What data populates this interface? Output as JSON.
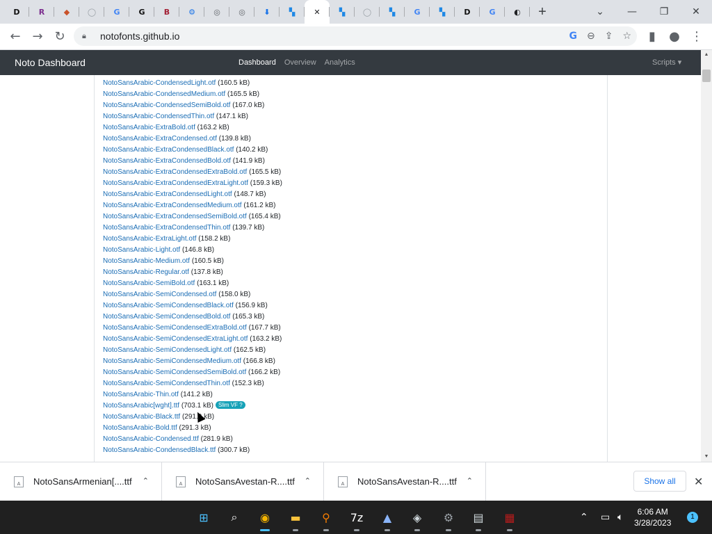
{
  "browser": {
    "tabs": [
      {
        "icon": "dafont-icon",
        "glyph": "D",
        "color": "#111111"
      },
      {
        "icon": "winrar-icon",
        "glyph": "R",
        "color": "#7b2d8e"
      },
      {
        "icon": "extension-icon",
        "glyph": "◆",
        "color": "#c9522a"
      },
      {
        "icon": "github-icon",
        "glyph": "◯",
        "color": "#9aa0a6"
      },
      {
        "icon": "google-icon",
        "glyph": "G",
        "color": "#4285f4"
      },
      {
        "icon": "google-g-icon",
        "glyph": "G",
        "color": "#111111"
      },
      {
        "icon": "font-book-icon",
        "glyph": "B",
        "color": "#a32035"
      },
      {
        "icon": "settings-icon",
        "glyph": "⚙",
        "color": "#1a73e8"
      },
      {
        "icon": "globe-icon",
        "glyph": "◎",
        "color": "#5f6368"
      },
      {
        "icon": "globe-icon",
        "glyph": "◎",
        "color": "#5f6368"
      },
      {
        "icon": "download-icon",
        "glyph": "⬇",
        "color": "#1a73e8"
      },
      {
        "icon": "noto-icon",
        "glyph": "▚",
        "color": "#1e88e5"
      },
      {
        "icon": "active-tab-close-icon",
        "glyph": "✕",
        "color": "#202124"
      },
      {
        "icon": "noto-icon",
        "glyph": "▚",
        "color": "#1e88e5"
      },
      {
        "icon": "github-icon",
        "glyph": "◯",
        "color": "#9aa0a6"
      },
      {
        "icon": "noto-icon",
        "glyph": "▚",
        "color": "#1e88e5"
      },
      {
        "icon": "google-icon",
        "glyph": "G",
        "color": "#4285f4"
      },
      {
        "icon": "noto-icon",
        "glyph": "▚",
        "color": "#1e88e5"
      },
      {
        "icon": "dafont-icon",
        "glyph": "D",
        "color": "#111111"
      },
      {
        "icon": "google-icon",
        "glyph": "G",
        "color": "#4285f4"
      },
      {
        "icon": "globe-icon",
        "glyph": "◐",
        "color": "#202124"
      }
    ],
    "url": "notofonts.github.io"
  },
  "site": {
    "brand": "Noto Dashboard",
    "nav": [
      "Dashboard",
      "Overview",
      "Analytics"
    ],
    "scripts": "Scripts"
  },
  "files": [
    {
      "name": "NotoSansArabic-CondensedLight.otf",
      "size": "(160.5 kB)"
    },
    {
      "name": "NotoSansArabic-CondensedMedium.otf",
      "size": "(165.5 kB)"
    },
    {
      "name": "NotoSansArabic-CondensedSemiBold.otf",
      "size": "(167.0 kB)"
    },
    {
      "name": "NotoSansArabic-CondensedThin.otf",
      "size": "(147.1 kB)"
    },
    {
      "name": "NotoSansArabic-ExtraBold.otf",
      "size": "(163.2 kB)"
    },
    {
      "name": "NotoSansArabic-ExtraCondensed.otf",
      "size": "(139.8 kB)"
    },
    {
      "name": "NotoSansArabic-ExtraCondensedBlack.otf",
      "size": "(140.2 kB)"
    },
    {
      "name": "NotoSansArabic-ExtraCondensedBold.otf",
      "size": "(141.9 kB)"
    },
    {
      "name": "NotoSansArabic-ExtraCondensedExtraBold.otf",
      "size": "(165.5 kB)"
    },
    {
      "name": "NotoSansArabic-ExtraCondensedExtraLight.otf",
      "size": "(159.3 kB)"
    },
    {
      "name": "NotoSansArabic-ExtraCondensedLight.otf",
      "size": "(148.7 kB)"
    },
    {
      "name": "NotoSansArabic-ExtraCondensedMedium.otf",
      "size": "(161.2 kB)"
    },
    {
      "name": "NotoSansArabic-ExtraCondensedSemiBold.otf",
      "size": "(165.4 kB)"
    },
    {
      "name": "NotoSansArabic-ExtraCondensedThin.otf",
      "size": "(139.7 kB)"
    },
    {
      "name": "NotoSansArabic-ExtraLight.otf",
      "size": "(158.2 kB)"
    },
    {
      "name": "NotoSansArabic-Light.otf",
      "size": "(146.8 kB)"
    },
    {
      "name": "NotoSansArabic-Medium.otf",
      "size": "(160.5 kB)"
    },
    {
      "name": "NotoSansArabic-Regular.otf",
      "size": "(137.8 kB)"
    },
    {
      "name": "NotoSansArabic-SemiBold.otf",
      "size": "(163.1 kB)"
    },
    {
      "name": "NotoSansArabic-SemiCondensed.otf",
      "size": "(158.0 kB)"
    },
    {
      "name": "NotoSansArabic-SemiCondensedBlack.otf",
      "size": "(156.9 kB)"
    },
    {
      "name": "NotoSansArabic-SemiCondensedBold.otf",
      "size": "(165.3 kB)"
    },
    {
      "name": "NotoSansArabic-SemiCondensedExtraBold.otf",
      "size": "(167.7 kB)"
    },
    {
      "name": "NotoSansArabic-SemiCondensedExtraLight.otf",
      "size": "(163.2 kB)"
    },
    {
      "name": "NotoSansArabic-SemiCondensedLight.otf",
      "size": "(162.5 kB)"
    },
    {
      "name": "NotoSansArabic-SemiCondensedMedium.otf",
      "size": "(166.8 kB)"
    },
    {
      "name": "NotoSansArabic-SemiCondensedSemiBold.otf",
      "size": "(166.2 kB)"
    },
    {
      "name": "NotoSansArabic-SemiCondensedThin.otf",
      "size": "(152.3 kB)"
    },
    {
      "name": "NotoSansArabic-Thin.otf",
      "size": "(141.2 kB)"
    },
    {
      "name": "NotoSansArabic[wght].ttf",
      "size": "(703.1 kB)",
      "badge": "Slim VF ?"
    },
    {
      "name": "NotoSansArabic-Black.ttf",
      "size": "(291.9 kB)"
    },
    {
      "name": "NotoSansArabic-Bold.ttf",
      "size": "(291.3 kB)"
    },
    {
      "name": "NotoSansArabic-Condensed.ttf",
      "size": "(281.9 kB)"
    },
    {
      "name": "NotoSansArabic-CondensedBlack.ttf",
      "size": "(300.7 kB)"
    }
  ],
  "downloads": [
    {
      "name": "NotoSansArmenian[....ttf"
    },
    {
      "name": "NotoSansAvestan-R....ttf"
    },
    {
      "name": "NotoSansAvestan-R....ttf"
    }
  ],
  "shelf": {
    "show_all": "Show all"
  },
  "taskbar": {
    "apps": [
      {
        "name": "windows-start-icon",
        "glyph": "⊞",
        "color": "#4cc2ff",
        "active": false
      },
      {
        "name": "search-icon",
        "glyph": "⌕",
        "color": "#ffffff",
        "active": false
      },
      {
        "name": "chrome-icon",
        "glyph": "◉",
        "color": "#f4b400",
        "active": true
      },
      {
        "name": "file-explorer-icon",
        "glyph": "▬",
        "color": "#f9c23c",
        "active": false
      },
      {
        "name": "search-tool-icon",
        "glyph": "⚲",
        "color": "#f57c00",
        "active": false
      },
      {
        "name": "7zip-icon",
        "glyph": "7z",
        "color": "#ffffff",
        "active": false
      },
      {
        "name": "inkscape-icon",
        "glyph": "▲",
        "color": "#8ab4f8",
        "active": false
      },
      {
        "name": "app-icon",
        "glyph": "◈",
        "color": "#cfd8dc",
        "active": false
      },
      {
        "name": "settings-icon",
        "glyph": "⚙",
        "color": "#9aa0a6",
        "active": false
      },
      {
        "name": "clipboard-icon",
        "glyph": "▤",
        "color": "#cfd8dc",
        "active": false
      },
      {
        "name": "winrar-icon",
        "glyph": "▦",
        "color": "#b71c1c",
        "active": false
      }
    ],
    "time": "6:06 AM",
    "date": "3/28/2023",
    "notifications": "1"
  }
}
